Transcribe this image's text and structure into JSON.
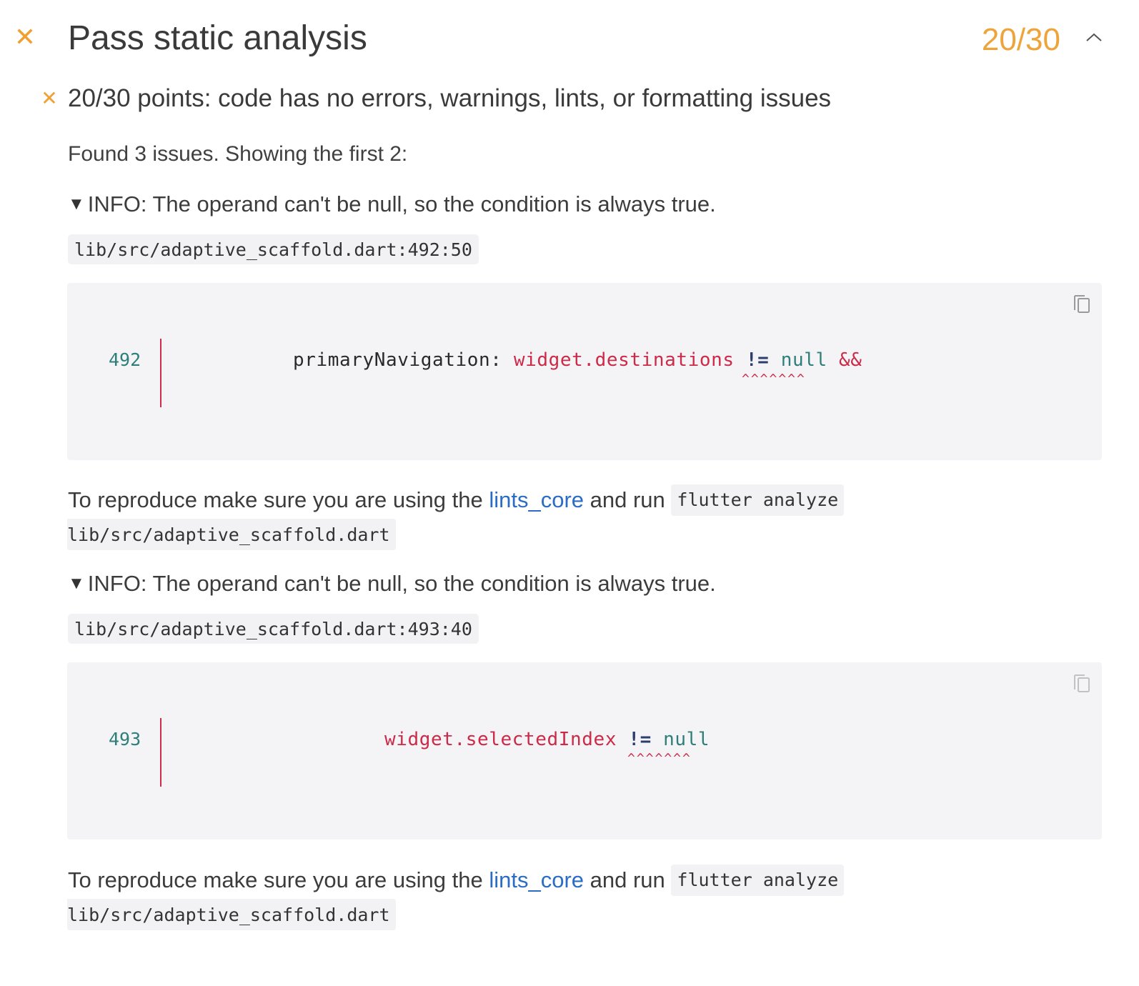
{
  "header": {
    "status_icon": "close-icon",
    "title": "Pass static analysis",
    "score": "20/30",
    "toggle_icon": "chevron-up-icon",
    "accent_color": "#eea43a"
  },
  "subsection": {
    "status_icon": "close-icon",
    "title": "20/30 points: code has no errors, warnings, lints, or formatting issues",
    "found_text": "Found 3 issues. Showing the first 2:"
  },
  "issues": [
    {
      "summary_marker": "▼",
      "summary": "INFO: The operand can't be null, so the condition is always true.",
      "location": "lib/src/adaptive_scaffold.dart:492:50",
      "line_number": "492",
      "code_indent": "primaryNavigation: ",
      "code_target": "widget.destinations",
      "code_op": "!=",
      "code_null": "null",
      "code_tail": "&&",
      "carets": "^^^^^^^",
      "copy_icon": "copy-icon",
      "repro_prefix": "To reproduce make sure you are using the ",
      "repro_link": "lints_core",
      "repro_mid": " and run ",
      "repro_cmd_1": "flutter analyze",
      "repro_cmd_2": "lib/src/adaptive_scaffold.dart"
    },
    {
      "summary_marker": "▼",
      "summary": "INFO: The operand can't be null, so the condition is always true.",
      "location": "lib/src/adaptive_scaffold.dart:493:40",
      "line_number": "493",
      "code_target": "widget.selectedIndex",
      "code_op": "!=",
      "code_null": "null",
      "carets": "^^^^^^^",
      "copy_icon": "copy-icon",
      "repro_prefix": "To reproduce make sure you are using the ",
      "repro_link": "lints_core",
      "repro_mid": " and run ",
      "repro_cmd_1": "flutter analyze",
      "repro_cmd_2": "lib/src/adaptive_scaffold.dart"
    }
  ]
}
